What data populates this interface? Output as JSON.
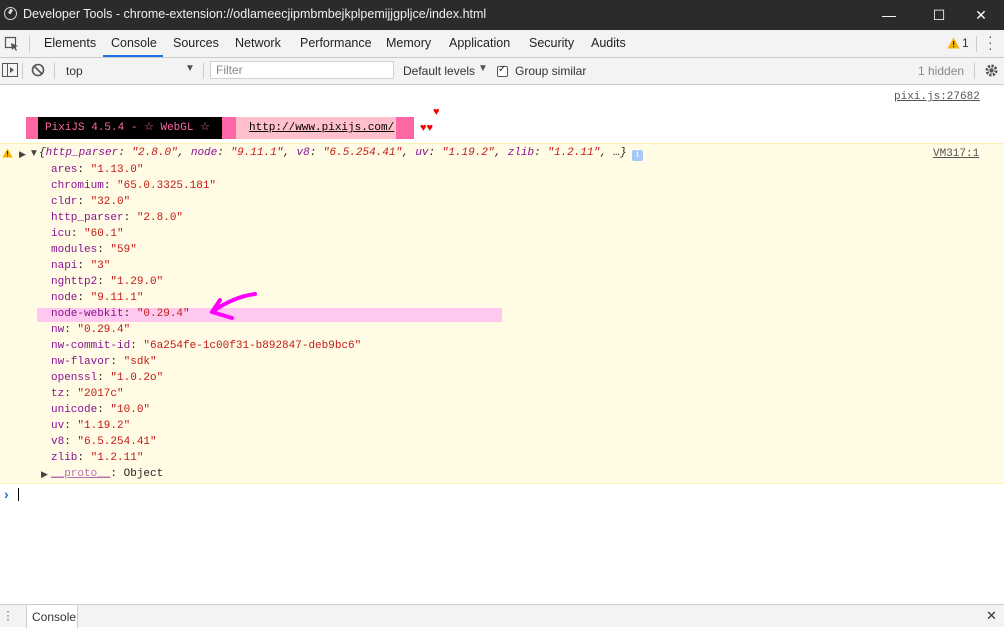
{
  "window": {
    "title": "Developer Tools - chrome-extension://odlameecjipmbmbejkplpemijjgpljce/index.html",
    "minimize": "—",
    "maximize": "☐",
    "close": "✕"
  },
  "tabs": [
    "Elements",
    "Console",
    "Sources",
    "Network",
    "Performance",
    "Memory",
    "Application",
    "Security",
    "Audits"
  ],
  "active_tab": "Console",
  "warnings_badge": "1",
  "toolbar": {
    "context": "top",
    "filter_placeholder": "Filter",
    "levels": "Default levels",
    "group_similar": "Group similar",
    "hidden": "1 hidden"
  },
  "console": {
    "pixi_source": "pixi.js:27682",
    "pixi_banner": "PixiJS 4.5.4 - ☆ WebGL ☆",
    "pixi_url": "http://www.pixijs.com/",
    "hearts_top": "♥",
    "hearts_bottom": "♥♥",
    "summary_prefix": "{",
    "summary_items": [
      {
        "key": "http_parser",
        "value": "\"2.8.0\""
      },
      {
        "key": "node",
        "value": "\"9.11.1\""
      },
      {
        "key": "v8",
        "value": "\"6.5.254.41\""
      },
      {
        "key": "uv",
        "value": "\"1.19.2\""
      },
      {
        "key": "zlib",
        "value": "\"1.2.11\""
      }
    ],
    "summary_suffix": "…}",
    "vm_source": "VM317:1",
    "properties": [
      {
        "key": "ares",
        "value": "\"1.13.0\""
      },
      {
        "key": "chromium",
        "value": "\"65.0.3325.181\""
      },
      {
        "key": "cldr",
        "value": "\"32.0\""
      },
      {
        "key": "http_parser",
        "value": "\"2.8.0\""
      },
      {
        "key": "icu",
        "value": "\"60.1\""
      },
      {
        "key": "modules",
        "value": "\"59\""
      },
      {
        "key": "napi",
        "value": "\"3\""
      },
      {
        "key": "nghttp2",
        "value": "\"1.29.0\""
      },
      {
        "key": "node",
        "value": "\"9.11.1\""
      },
      {
        "key": "node-webkit",
        "value": "\"0.29.4\""
      },
      {
        "key": "nw",
        "value": "\"0.29.4\""
      },
      {
        "key": "nw-commit-id",
        "value": "\"6a254fe-1c00f31-b892847-deb9bc6\""
      },
      {
        "key": "nw-flavor",
        "value": "\"sdk\""
      },
      {
        "key": "openssl",
        "value": "\"1.0.2o\""
      },
      {
        "key": "tz",
        "value": "\"2017c\""
      },
      {
        "key": "unicode",
        "value": "\"10.0\""
      },
      {
        "key": "uv",
        "value": "\"1.19.2\""
      },
      {
        "key": "v8",
        "value": "\"6.5.254.41\""
      },
      {
        "key": "zlib",
        "value": "\"1.2.11\""
      }
    ],
    "proto_key": "__proto__",
    "proto_value": "Object",
    "prompt": "›"
  },
  "drawer": {
    "tab": "Console",
    "close": "✕"
  },
  "colors": {
    "highlight": "#ffc8ee",
    "arrow": "#ff00ff",
    "pixi_pink": "#ff66a5"
  }
}
